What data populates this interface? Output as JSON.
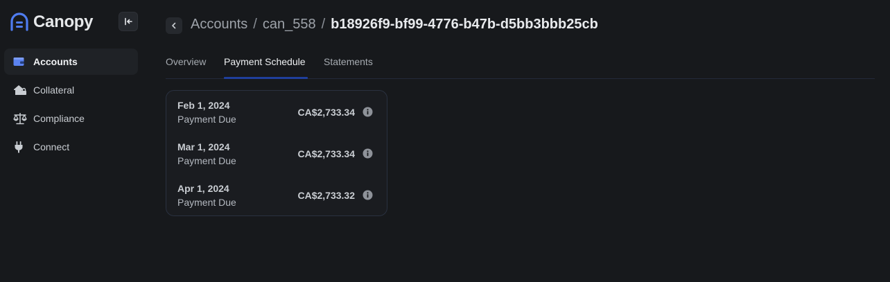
{
  "brand": {
    "name": "Canopy",
    "accent": "#4f7cf0"
  },
  "sidebar": {
    "collapse_icon": "collapse-left-icon",
    "items": [
      {
        "label": "Accounts",
        "icon": "wallet-icon",
        "active": true
      },
      {
        "label": "Collateral",
        "icon": "house-lock-icon",
        "active": false
      },
      {
        "label": "Compliance",
        "icon": "scale-icon",
        "active": false
      },
      {
        "label": "Connect",
        "icon": "plug-icon",
        "active": false
      }
    ]
  },
  "breadcrumb": {
    "items": [
      "Accounts",
      "can_558",
      "b18926f9-bf99-4776-b47b-d5bb3bbb25cb"
    ],
    "separator": "/"
  },
  "tabs": [
    {
      "label": "Overview",
      "active": false
    },
    {
      "label": "Payment Schedule",
      "active": true
    },
    {
      "label": "Statements",
      "active": false
    }
  ],
  "schedule": [
    {
      "date": "Feb 1, 2024",
      "status": "Payment Due",
      "amount": "CA$2,733.34"
    },
    {
      "date": "Mar 1, 2024",
      "status": "Payment Due",
      "amount": "CA$2,733.34"
    },
    {
      "date": "Apr 1, 2024",
      "status": "Payment Due",
      "amount": "CA$2,733.32"
    }
  ]
}
